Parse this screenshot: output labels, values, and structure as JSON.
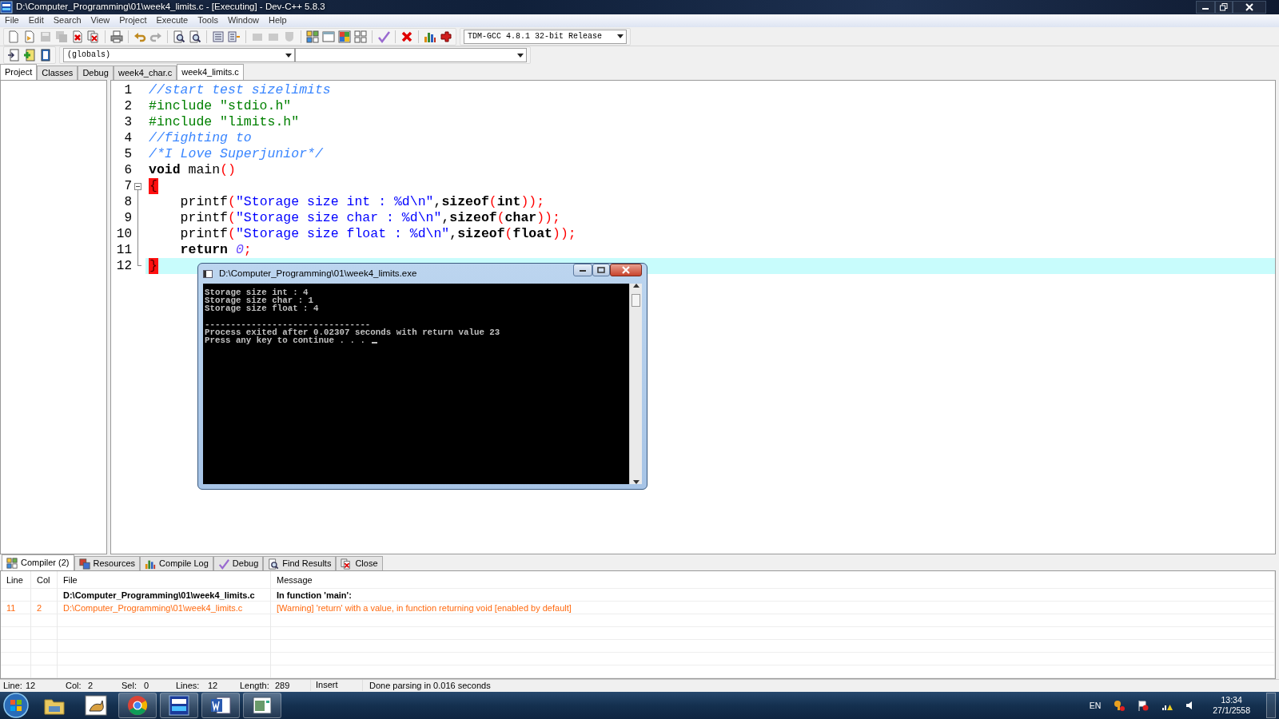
{
  "window": {
    "title": "D:\\Computer_Programming\\01\\week4_limits.c - [Executing] - Dev-C++ 5.8.3"
  },
  "menu": [
    {
      "label": "File"
    },
    {
      "label": "Edit"
    },
    {
      "label": "Search"
    },
    {
      "label": "View"
    },
    {
      "label": "Project"
    },
    {
      "label": "Execute"
    },
    {
      "label": "Tools"
    },
    {
      "label": "Window"
    },
    {
      "label": "Help"
    }
  ],
  "toolbar": {
    "compiler_select": {
      "value": "TDM-GCC 4.8.1 32-bit Release"
    },
    "scope_select": {
      "value": "(globals)"
    }
  },
  "side_tabs": [
    {
      "label": "Project",
      "selected": true
    },
    {
      "label": "Classes",
      "selected": false
    },
    {
      "label": "Debug",
      "selected": false
    }
  ],
  "editor_tabs": [
    {
      "label": "week4_char.c",
      "selected": false
    },
    {
      "label": "week4_limits.c",
      "selected": true
    }
  ],
  "editor": {
    "lines": [
      {
        "number": "1",
        "current": false,
        "tokens": [
          {
            "kind": "comment",
            "text": "//start test sizelimits"
          }
        ]
      },
      {
        "number": "2",
        "current": false,
        "tokens": [
          {
            "kind": "preproc",
            "text": "#include \"stdio.h\""
          }
        ]
      },
      {
        "number": "3",
        "current": false,
        "tokens": [
          {
            "kind": "preproc",
            "text": "#include \"limits.h\""
          }
        ]
      },
      {
        "number": "4",
        "current": false,
        "tokens": [
          {
            "kind": "comment",
            "text": "//fighting to"
          }
        ]
      },
      {
        "number": "5",
        "current": false,
        "tokens": [
          {
            "kind": "comment",
            "text": "/*I Love Superjunior*/"
          }
        ]
      },
      {
        "number": "6",
        "current": false,
        "tokens": [
          {
            "kind": "keyword",
            "text": "void"
          },
          {
            "kind": "plain",
            "text": " main"
          },
          {
            "kind": "symbol",
            "text": "()"
          }
        ]
      },
      {
        "number": "7",
        "current": false,
        "fold_start": true,
        "tokens": [
          {
            "kind": "brace_match",
            "text": "{"
          }
        ]
      },
      {
        "number": "8",
        "current": false,
        "indent": true,
        "tokens": [
          {
            "kind": "plain",
            "text": "printf"
          },
          {
            "kind": "symbol",
            "text": "("
          },
          {
            "kind": "string",
            "text": "\"Storage size int : %d\\n\""
          },
          {
            "kind": "plain",
            "text": ","
          },
          {
            "kind": "keyword",
            "text": "sizeof"
          },
          {
            "kind": "symbol",
            "text": "("
          },
          {
            "kind": "keyword",
            "text": "int"
          },
          {
            "kind": "symbol",
            "text": "));"
          }
        ]
      },
      {
        "number": "9",
        "current": false,
        "indent": true,
        "tokens": [
          {
            "kind": "plain",
            "text": "printf"
          },
          {
            "kind": "symbol",
            "text": "("
          },
          {
            "kind": "string",
            "text": "\"Storage size char : %d\\n\""
          },
          {
            "kind": "plain",
            "text": ","
          },
          {
            "kind": "keyword",
            "text": "sizeof"
          },
          {
            "kind": "symbol",
            "text": "("
          },
          {
            "kind": "keyword",
            "text": "char"
          },
          {
            "kind": "symbol",
            "text": "));"
          }
        ]
      },
      {
        "number": "10",
        "current": false,
        "indent": true,
        "tokens": [
          {
            "kind": "plain",
            "text": "printf"
          },
          {
            "kind": "symbol",
            "text": "("
          },
          {
            "kind": "string",
            "text": "\"Storage size float : %d\\n\""
          },
          {
            "kind": "plain",
            "text": ","
          },
          {
            "kind": "keyword",
            "text": "sizeof"
          },
          {
            "kind": "symbol",
            "text": "("
          },
          {
            "kind": "keyword",
            "text": "float"
          },
          {
            "kind": "symbol",
            "text": "));"
          }
        ]
      },
      {
        "number": "11",
        "current": false,
        "indent": true,
        "tokens": [
          {
            "kind": "keyword",
            "text": "return"
          },
          {
            "kind": "number",
            "text": " 0"
          },
          {
            "kind": "symbol",
            "text": ";"
          }
        ]
      },
      {
        "number": "12",
        "current": true,
        "fold_end": true,
        "tokens": [
          {
            "kind": "brace_match",
            "text": "}"
          }
        ]
      }
    ]
  },
  "console": {
    "title": "D:\\Computer_Programming\\01\\week4_limits.exe",
    "cursor": true,
    "blocks": [
      [
        "Storage size int : 4",
        "Storage size char : 1",
        "Storage size float : 4"
      ],
      [
        "--------------------------------",
        "Process exited after 0.02307 seconds with return value 23",
        "Press any key to continue . . ."
      ]
    ]
  },
  "bottom_tabs": [
    {
      "label": "Compiler (2)",
      "selected": true
    },
    {
      "label": "Resources",
      "selected": false
    },
    {
      "label": "Compile Log",
      "selected": false
    },
    {
      "label": "Debug",
      "selected": false
    },
    {
      "label": "Find Results",
      "selected": false
    },
    {
      "label": "Close",
      "selected": false
    }
  ],
  "messages": {
    "columns": [
      "Line",
      "Col",
      "File",
      "Message"
    ],
    "rows": [
      {
        "kind": "context",
        "file": "D:\\Computer_Programming\\01\\week4_limits.c",
        "message": "In function 'main':"
      },
      {
        "kind": "warning",
        "line": "11",
        "col": "2",
        "file": "D:\\Computer_Programming\\01\\week4_limits.c",
        "message": "[Warning] 'return' with a value, in function returning void [enabled by default]"
      }
    ]
  },
  "status_bar": {
    "fields": [
      {
        "label": "Line:",
        "value": "12"
      },
      {
        "label": "Col:",
        "value": "2"
      },
      {
        "label": "Sel:",
        "value": "0"
      },
      {
        "label": "Lines:",
        "value": "12"
      },
      {
        "label": "Length:",
        "value": "289"
      }
    ],
    "mode": "Insert",
    "message": "Done parsing in 0.016 seconds"
  },
  "taskbar": {
    "language": "EN",
    "time": "13:34",
    "date": "27/1/2558"
  }
}
